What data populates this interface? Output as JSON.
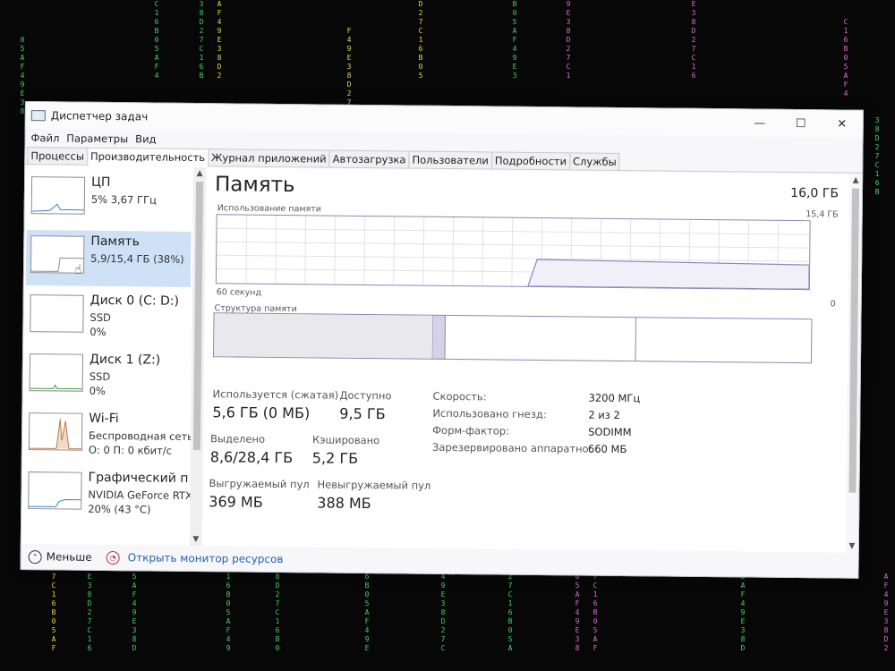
{
  "window": {
    "title": "Диспетчер задач",
    "controls": {
      "minimize": "—",
      "maximize": "☐",
      "close": "✕"
    }
  },
  "menu": [
    "Файл",
    "Параметры",
    "Вид"
  ],
  "tabs": [
    {
      "label": "Процессы"
    },
    {
      "label": "Производительность"
    },
    {
      "label": "Журнал приложений"
    },
    {
      "label": "Автозагрузка"
    },
    {
      "label": "Пользователи"
    },
    {
      "label": "Подробности"
    },
    {
      "label": "Службы"
    }
  ],
  "active_tab": "Производительность",
  "sidebar": {
    "items": [
      {
        "title": "ЦП",
        "line1": "5%  3,67 ГГц",
        "line2": ""
      },
      {
        "title": "Память",
        "line1": "5,9/15,4 ГБ (38%)",
        "line2": ""
      },
      {
        "title": "Диск 0 (C: D:)",
        "line1": "SSD",
        "line2": "0%"
      },
      {
        "title": "Диск 1 (Z:)",
        "line1": "SSD",
        "line2": "0%"
      },
      {
        "title": "Wi-Fi",
        "line1": "Беспроводная сеть",
        "line2": "О: 0 П: 0 кбит/с"
      },
      {
        "title": "Графический п",
        "line1": "NVIDIA GeForce RTX",
        "line2": "20% (43 °C)"
      }
    ],
    "selected": "Память"
  },
  "memory": {
    "title": "Память",
    "total": "16,0 ГБ",
    "usage_label": "Использование памяти",
    "usage_max": "15,4 ГБ",
    "time_left": "60 секунд",
    "time_right": "0",
    "composition_label": "Структура памяти",
    "in_use_label": "Используется (сжатая)",
    "in_use_value": "5,6 ГБ (0 МБ)",
    "available_label": "Доступно",
    "available_value": "9,5 ГБ",
    "committed_label": "Выделено",
    "committed_value": "8,6/28,4 ГБ",
    "cached_label": "Кэшировано",
    "cached_value": "5,2 ГБ",
    "paged_label": "Выгружаемый пул",
    "paged_value": "369 МБ",
    "nonpaged_label": "Невыгружаемый пул",
    "nonpaged_value": "388 МБ",
    "details": [
      {
        "label": "Скорость:",
        "value": "3200 МГц"
      },
      {
        "label": "Использовано гнезд:",
        "value": "2 из 2"
      },
      {
        "label": "Форм-фактор:",
        "value": "SODIMM"
      },
      {
        "label": "Зарезервировано аппаратно:",
        "value": "660 МБ"
      }
    ]
  },
  "footer": {
    "fewer_label": "Меньше",
    "resource_monitor_label": "Открыть монитор ресурсов"
  },
  "colors": {
    "memory_graph": "#8f84b8",
    "selected_bg": "#cfe1f6",
    "link": "#1f5fb5",
    "matrix_green": "#47d16a",
    "matrix_yellow": "#e6d84a",
    "matrix_pink": "#d86fd0"
  }
}
